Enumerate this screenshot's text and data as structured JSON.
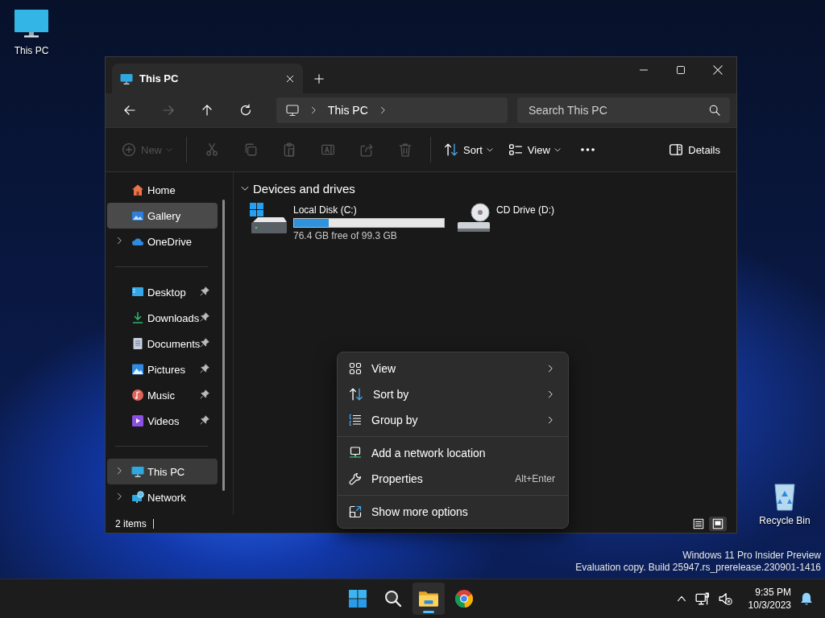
{
  "desktop_icons": [
    {
      "kind": "pc",
      "label": "This PC"
    },
    {
      "kind": "bin",
      "label": "Recycle Bin"
    }
  ],
  "window": {
    "tabs": [
      {
        "label": "This PC",
        "selected": true
      }
    ],
    "breadcrumb": [
      "This PC"
    ],
    "search": {
      "placeholder": "Search This PC"
    },
    "toolbar": [
      {
        "kind": "new",
        "label": "New",
        "dropdown": true,
        "disabled": true
      },
      {
        "kind": "divider"
      },
      {
        "kind": "cut",
        "disabled": true
      },
      {
        "kind": "copy",
        "disabled": true
      },
      {
        "kind": "paste",
        "disabled": true
      },
      {
        "kind": "rename",
        "disabled": true
      },
      {
        "kind": "share",
        "disabled": true
      },
      {
        "kind": "delete",
        "disabled": true
      },
      {
        "kind": "divider"
      },
      {
        "kind": "sort",
        "label": "Sort",
        "dropdown": true,
        "disabled": false
      },
      {
        "kind": "view",
        "label": "View",
        "dropdown": true,
        "disabled": false
      },
      {
        "kind": "more",
        "disabled": false
      }
    ],
    "details": {
      "label": "Details"
    },
    "nav_groups": [
      [
        {
          "kind": "home",
          "label": "Home",
          "expandable": false,
          "pinned": false,
          "selected": false,
          "hovered": false
        },
        {
          "kind": "gallery",
          "label": "Gallery",
          "expandable": false,
          "pinned": false,
          "selected": false,
          "hovered": true
        },
        {
          "kind": "onedrive",
          "label": "OneDrive",
          "expandable": true,
          "pinned": false,
          "selected": false,
          "hovered": false
        }
      ],
      [
        {
          "kind": "desktop",
          "label": "Desktop",
          "expandable": false,
          "pinned": true,
          "selected": false,
          "hovered": false
        },
        {
          "kind": "downloads",
          "label": "Downloads",
          "expandable": false,
          "pinned": true,
          "selected": false,
          "hovered": false
        },
        {
          "kind": "documents",
          "label": "Documents",
          "expandable": false,
          "pinned": true,
          "selected": false,
          "hovered": false
        },
        {
          "kind": "pictures",
          "label": "Pictures",
          "expandable": false,
          "pinned": true,
          "selected": false,
          "hovered": false
        },
        {
          "kind": "music",
          "label": "Music",
          "expandable": false,
          "pinned": true,
          "selected": false,
          "hovered": false
        },
        {
          "kind": "videos",
          "label": "Videos",
          "expandable": false,
          "pinned": true,
          "selected": false,
          "hovered": false
        }
      ],
      [
        {
          "kind": "pc",
          "label": "This PC",
          "expandable": true,
          "pinned": false,
          "selected": true,
          "hovered": false
        },
        {
          "kind": "network",
          "label": "Network",
          "expandable": true,
          "pinned": false,
          "selected": false,
          "hovered": false
        }
      ]
    ],
    "sections": [
      {
        "title": "Devices and drives",
        "expanded": true,
        "drives": [
          {
            "kind": "disk",
            "name": "Local Disk (C:)",
            "level": 0.23,
            "reading": "76.4 GB free of 99.3 GB"
          },
          {
            "kind": "cd",
            "name": "CD Drive (D:)"
          }
        ]
      }
    ],
    "status": {
      "count": "2 items"
    },
    "view_modes": [
      {
        "kind": "details",
        "selected": false
      },
      {
        "kind": "tiles",
        "selected": true
      }
    ]
  },
  "context_menu": [
    [
      {
        "kind": "view",
        "label": "View",
        "submenu": true
      },
      {
        "kind": "sort",
        "label": "Sort by",
        "submenu": true
      },
      {
        "kind": "group",
        "label": "Group by",
        "submenu": true
      }
    ],
    [
      {
        "kind": "network",
        "label": "Add a network location",
        "submenu": false
      },
      {
        "kind": "properties",
        "label": "Properties",
        "submenu": false,
        "shortcut": "Alt+Enter"
      }
    ],
    [
      {
        "kind": "expand",
        "label": "Show more options",
        "submenu": false
      }
    ]
  ],
  "watermark": [
    "Windows 11 Pro Insider Preview",
    "Evaluation copy. Build 25947.rs_prerelease.230901-1416"
  ],
  "taskbar": {
    "apps": [
      {
        "kind": "start",
        "active": false
      },
      {
        "kind": "search",
        "active": false
      },
      {
        "kind": "explorer",
        "active": true
      },
      {
        "kind": "chrome",
        "active": false
      }
    ],
    "time": "9:35 PM",
    "date": "10/3/2023"
  }
}
